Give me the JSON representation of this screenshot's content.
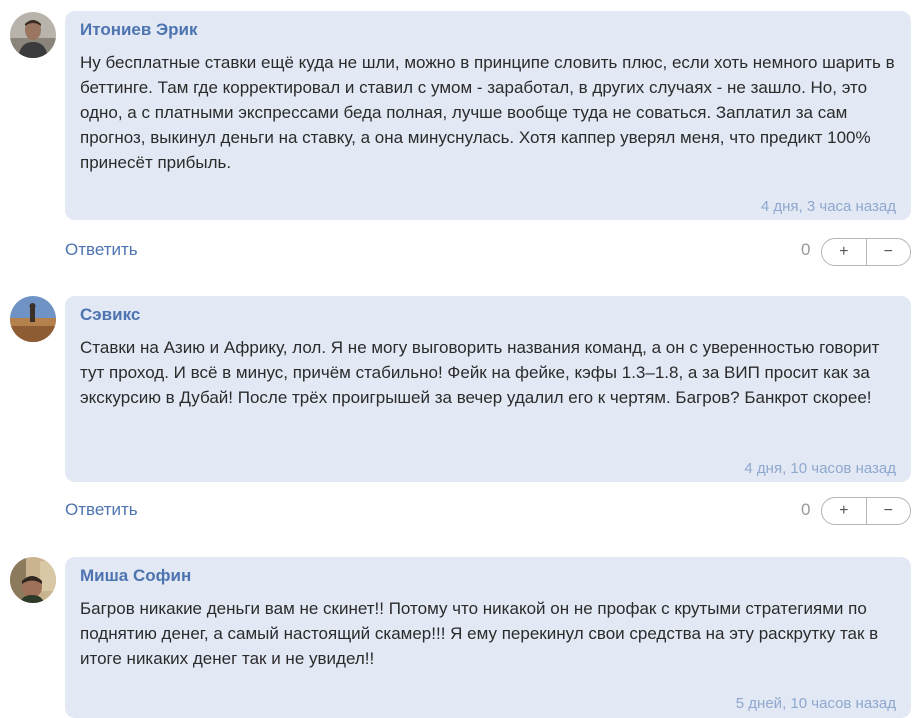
{
  "comments": [
    {
      "author": "Итониев Эрик",
      "text": "Ну бесплатные ставки ещё куда не шли, можно в принципе словить плюс, если хоть немного шарить в беттинге. Там где корректировал и ставил с умом - заработал, в других случаях - не зашло. Но, это одно, а с платными экспрессами беда полная, лучше вообще туда не соваться. Заплатил за сам прогноз, выкинул деньги на ставку, а она минуснулась. Хотя каппер уверял меня, что предикт 100% принесёт прибыль.",
      "time": "4 дня, 3 часа назад",
      "reply_label": "Ответить",
      "score": "0",
      "plus": "+",
      "minus": "−"
    },
    {
      "author": "Сэвикс",
      "text": "Ставки на Азию и Африку, лол. Я не могу выговорить названия команд, а он с уверенностью говорит тут проход. И всё в минус, причём стабильно! Фейк на фейке, кэфы 1.3–1.8, а за ВИП просит как за экскурсию в Дубай! После трёх проигрышей за вечер удалил его к чертям. Багров? Банкрот скорее!",
      "time": "4 дня, 10 часов назад",
      "reply_label": "Ответить",
      "score": "0",
      "plus": "+",
      "minus": "−"
    },
    {
      "author": "Миша Софин",
      "text": "Багров никакие деньги вам не скинет!! Потому что никакой он не профак с крутыми стратегиями по поднятию денег, а самый настоящий скамер!!! Я ему перекинул свои средства на эту раскрутку так в итоге никаких денег так и не увидел!!",
      "time": "5 дней, 10 часов назад"
    }
  ]
}
